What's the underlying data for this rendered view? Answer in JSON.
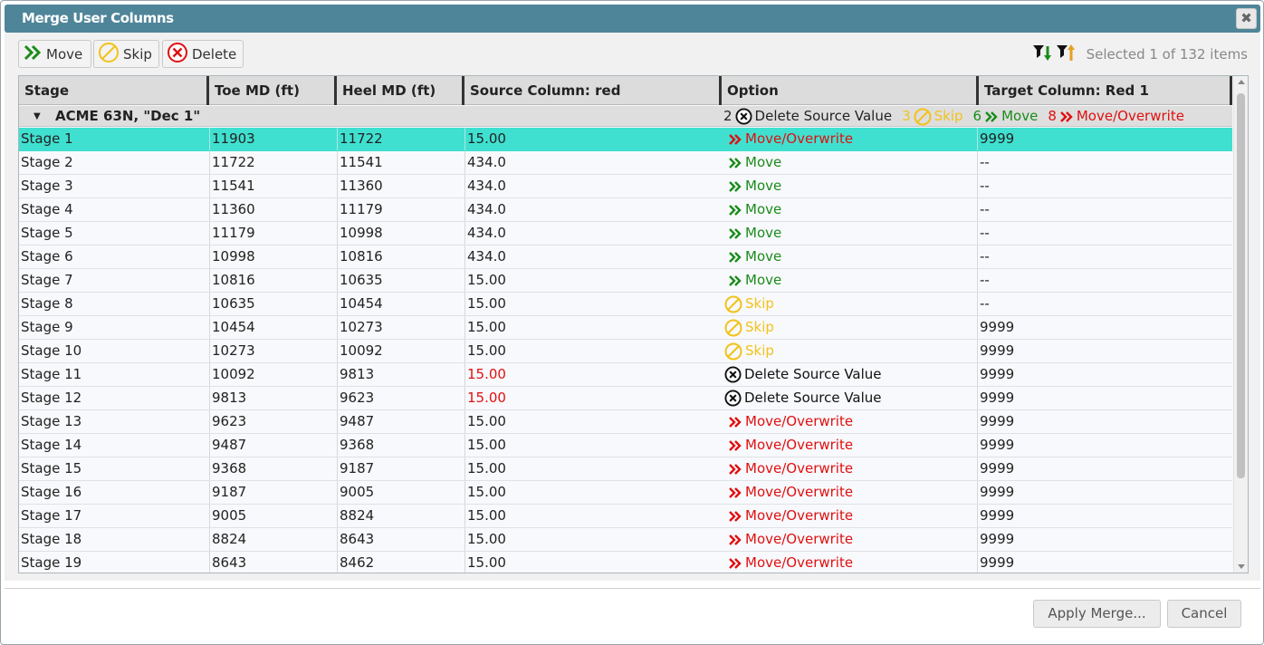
{
  "window": {
    "title": "Merge User Columns",
    "close": "✖"
  },
  "toolbar": {
    "move_label": "Move",
    "skip_label": "Skip",
    "delete_label": "Delete",
    "selection_info": "Selected 1 of 132 items"
  },
  "columns": {
    "stage": "Stage",
    "toe": "Toe MD (ft)",
    "heel": "Heel MD (ft)",
    "source": "Source Column: red",
    "option": "Option",
    "target": "Target Column: Red 1"
  },
  "group": {
    "toggle": "▼",
    "name": "ACME 63N, \"Dec 1\"",
    "summary": {
      "delete_count": "2",
      "delete_label": "Delete Source Value",
      "skip_count": "3",
      "skip_label": "Skip",
      "move_count": "6",
      "move_label": "Move",
      "overwrite_count": "8",
      "overwrite_label": "Move/Overwrite"
    }
  },
  "rows": [
    {
      "stage": "Stage 1",
      "toe": "11903",
      "heel": "11722",
      "source": "15.00",
      "option": "Move/Overwrite",
      "target": "9999",
      "selected": true
    },
    {
      "stage": "Stage 2",
      "toe": "11722",
      "heel": "11541",
      "source": "434.0",
      "option": "Move",
      "target": "--"
    },
    {
      "stage": "Stage 3",
      "toe": "11541",
      "heel": "11360",
      "source": "434.0",
      "option": "Move",
      "target": "--"
    },
    {
      "stage": "Stage 4",
      "toe": "11360",
      "heel": "11179",
      "source": "434.0",
      "option": "Move",
      "target": "--"
    },
    {
      "stage": "Stage 5",
      "toe": "11179",
      "heel": "10998",
      "source": "434.0",
      "option": "Move",
      "target": "--"
    },
    {
      "stage": "Stage 6",
      "toe": "10998",
      "heel": "10816",
      "source": "434.0",
      "option": "Move",
      "target": "--"
    },
    {
      "stage": "Stage 7",
      "toe": "10816",
      "heel": "10635",
      "source": "15.00",
      "option": "Move",
      "target": "--"
    },
    {
      "stage": "Stage 8",
      "toe": "10635",
      "heel": "10454",
      "source": "15.00",
      "option": "Skip",
      "target": "--"
    },
    {
      "stage": "Stage 9",
      "toe": "10454",
      "heel": "10273",
      "source": "15.00",
      "option": "Skip",
      "target": "9999"
    },
    {
      "stage": "Stage 10",
      "toe": "10273",
      "heel": "10092",
      "source": "15.00",
      "option": "Skip",
      "target": "9999"
    },
    {
      "stage": "Stage 11",
      "toe": "10092",
      "heel": "9813",
      "source": "15.00",
      "option": "Delete Source Value",
      "target": "9999",
      "source_red": true
    },
    {
      "stage": "Stage 12",
      "toe": "9813",
      "heel": "9623",
      "source": "15.00",
      "option": "Delete Source Value",
      "target": "9999",
      "source_red": true
    },
    {
      "stage": "Stage 13",
      "toe": "9623",
      "heel": "9487",
      "source": "15.00",
      "option": "Move/Overwrite",
      "target": "9999"
    },
    {
      "stage": "Stage 14",
      "toe": "9487",
      "heel": "9368",
      "source": "15.00",
      "option": "Move/Overwrite",
      "target": "9999"
    },
    {
      "stage": "Stage 15",
      "toe": "9368",
      "heel": "9187",
      "source": "15.00",
      "option": "Move/Overwrite",
      "target": "9999"
    },
    {
      "stage": "Stage 16",
      "toe": "9187",
      "heel": "9005",
      "source": "15.00",
      "option": "Move/Overwrite",
      "target": "9999"
    },
    {
      "stage": "Stage 17",
      "toe": "9005",
      "heel": "8824",
      "source": "15.00",
      "option": "Move/Overwrite",
      "target": "9999"
    },
    {
      "stage": "Stage 18",
      "toe": "8824",
      "heel": "8643",
      "source": "15.00",
      "option": "Move/Overwrite",
      "target": "9999"
    },
    {
      "stage": "Stage 19",
      "toe": "8643",
      "heel": "8462",
      "source": "15.00",
      "option": "Move/Overwrite",
      "target": "9999"
    }
  ],
  "footer": {
    "apply_label": "Apply Merge...",
    "cancel_label": "Cancel"
  },
  "colors": {
    "titlebar": "#4f8599",
    "selected_row": "#40e0d0",
    "move": "#1a8c1a",
    "overwrite": "#e01010",
    "skip": "#f2c21a",
    "delete": "#111111"
  },
  "icons": {
    "move": "double-chevron-right-green",
    "overwrite": "double-chevron-right-red",
    "skip": "circle-slash-yellow",
    "delete": "circle-x-black",
    "toolbar_delete": "circle-x-red",
    "filter_down": "filter-arrow-down-green",
    "filter_up": "filter-arrow-up-orange"
  }
}
